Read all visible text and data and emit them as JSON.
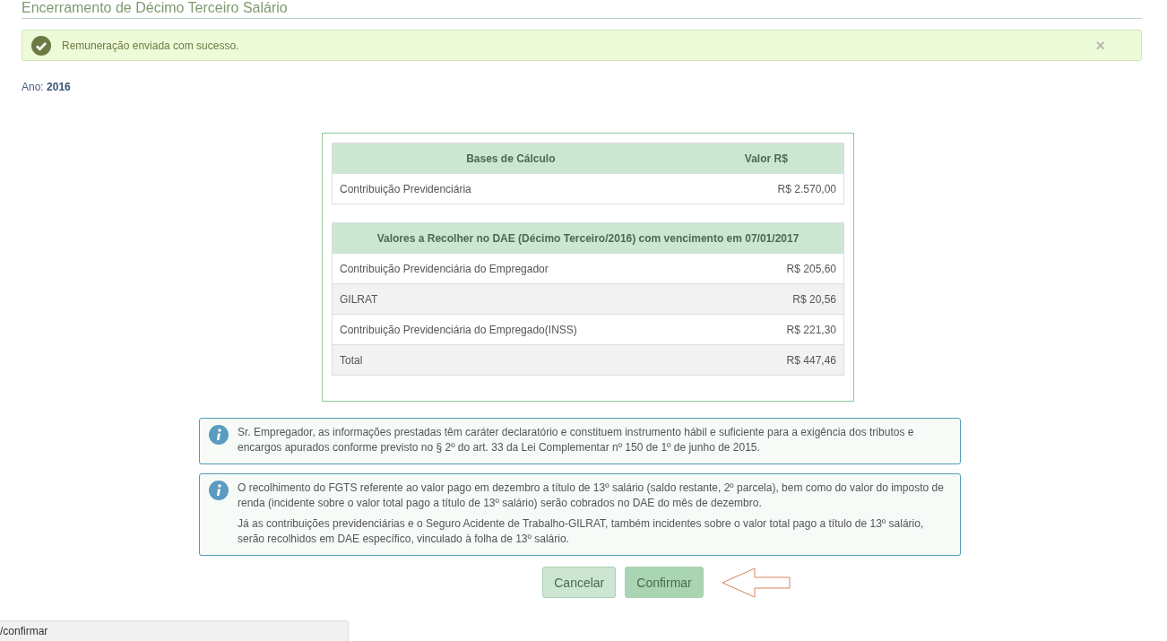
{
  "page_title": "Encerramento de Décimo Terceiro Salário",
  "alert": {
    "message": "Remuneração enviada com sucesso.",
    "close": "×"
  },
  "year_label": "Ano: **2016**",
  "bases_table": {
    "columns": [
      "Bases de Cálculo",
      "Valor R$"
    ],
    "rows": [
      {
        "label": "Contribuição Previdenciária",
        "value": "R$ 2.570,00"
      }
    ]
  },
  "dae_table": {
    "title": "Valores a Recolher no DAE (Décimo Terceiro/2016) com vencimento em 07/01/2017",
    "rows": [
      {
        "label": "Contribuição Previdenciária do Empregador",
        "value": "R$ 205,60"
      },
      {
        "label": "GILRAT",
        "value": "R$ 20,56"
      },
      {
        "label": "Contribuição Previdenciária do Empregado(INSS)",
        "value": "R$ 221,30"
      },
      {
        "label": "Total",
        "value": "R$ 447,46"
      }
    ]
  },
  "notices": [
    {
      "paragraphs": [
        "Sr. Empregador, as informações prestadas têm caráter declaratório e constituem instrumento hábil e suficiente para a exigência dos tributos e encargos apurados conforme previsto no § 2º do art. 33 da Lei Complementar nº 150 de 1º de junho de 2015."
      ]
    },
    {
      "paragraphs": [
        "O recolhimento do FGTS referente ao valor pago em dezembro a título de 13º salário (saldo restante, 2º parcela), bem como do valor do imposto de renda (incidente sobre o valor total pago a título de 13º salário) serão cobrados no DAE do mês de dezembro.",
        "Já as contribuições previdenciárias e o Seguro Acidente de Trabalho-GILRAT, também incidentes sobre o valor total pago a título de 13º salário, serão recolhidos em DAE específico, vinculado à folha de 13º salário."
      ]
    }
  ],
  "buttons": [
    {
      "label": "Cancelar",
      "selected": false
    },
    {
      "label": "Confirmar",
      "selected": true
    }
  ],
  "status_bar": "/confirmar"
}
